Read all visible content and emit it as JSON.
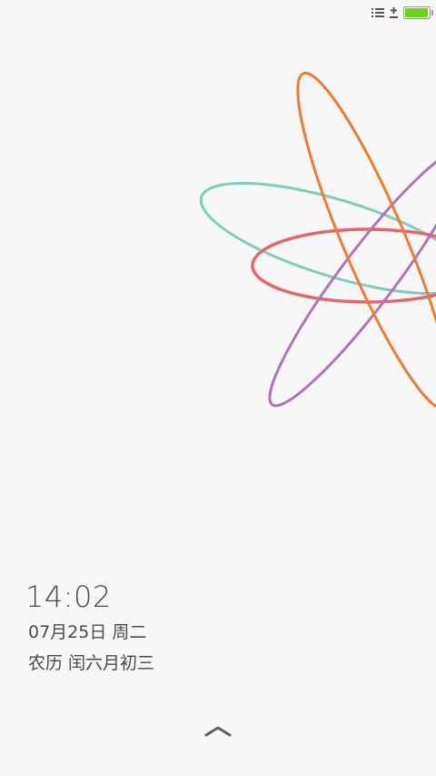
{
  "lock_screen": {
    "time": "14:02",
    "date": "07月25日 周二",
    "lunar_date": "农历 闰六月初三"
  },
  "status_bar": {
    "icons": [
      "notification-list-icon",
      "charging-icon",
      "battery-icon"
    ],
    "battery_level_percent": 95,
    "battery_color": "#6ad416"
  },
  "wallpaper": {
    "orbit_colors": {
      "orange": "#f07a2e",
      "teal": "#7fcdbf",
      "red": "#e8636b",
      "purple": "#ad77b4"
    }
  },
  "unlock_hint": {
    "icon": "chevron-up-icon"
  }
}
